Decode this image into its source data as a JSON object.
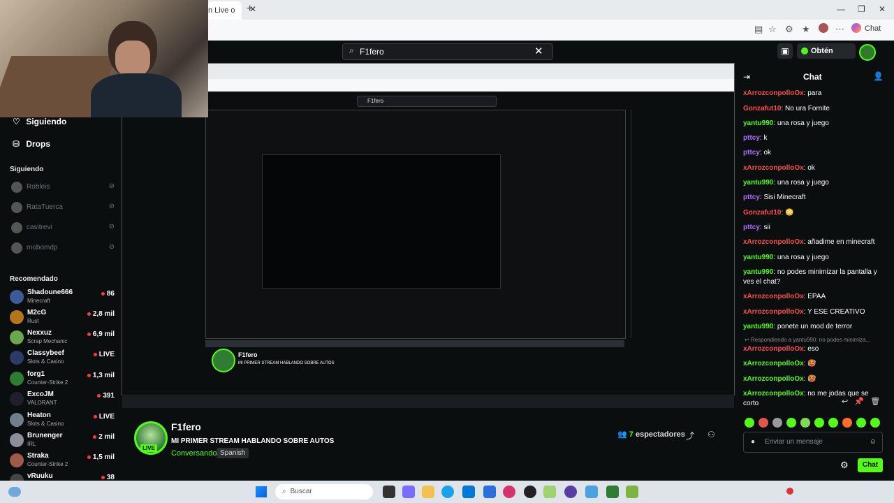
{
  "browser": {
    "tab_title": "n Live o",
    "tab_close": "✕",
    "new_tab": "+",
    "window_controls": [
      "—",
      "❐",
      "✕"
    ],
    "copilot_label": "Chat"
  },
  "header": {
    "search_value": "F1fero",
    "get_kicks_label": "Obtén KICKs"
  },
  "sidebar": {
    "following_link": "Siguiendo",
    "drops_link": "Drops",
    "following_title": "Siguiendo",
    "following": [
      {
        "name": "Robleis"
      },
      {
        "name": "RataTuerca"
      },
      {
        "name": "casitrevi"
      },
      {
        "name": "mobomdp"
      }
    ],
    "recommended_title": "Recomendado",
    "recommended": [
      {
        "name": "Shadoune666",
        "category": "Minecraft",
        "viewers": "86",
        "color": "#3c5a99"
      },
      {
        "name": "M2cG",
        "category": "Rust",
        "viewers": "2,8 mil",
        "color": "#b3761a"
      },
      {
        "name": "Nexxuz",
        "category": "Scrap Mechanic",
        "viewers": "6,9 mil",
        "color": "#6aa84f"
      },
      {
        "name": "Classybeef",
        "category": "Slots & Casino",
        "viewers": "LIVE",
        "color": "#2b3a67"
      },
      {
        "name": "forg1",
        "category": "Counter-Strike 2",
        "viewers": "1,3 mil",
        "color": "#2e7d32"
      },
      {
        "name": "ExcoJM",
        "category": "VALORANT",
        "viewers": "391",
        "color": "#1f1f2e"
      },
      {
        "name": "Heaton",
        "category": "Slots & Casino",
        "viewers": "LIVE",
        "color": "#6f7d8c"
      },
      {
        "name": "Brunenger",
        "category": "IRL",
        "viewers": "2 mil",
        "color": "#8e8e9a"
      },
      {
        "name": "Straka",
        "category": "Counter-Strike 2",
        "viewers": "1,5 mil",
        "color": "#a05a4a"
      },
      {
        "name": "vRuuku",
        "category": "",
        "viewers": "38",
        "color": "#444"
      }
    ]
  },
  "stream": {
    "streamer": "F1fero",
    "title": "MI PRIMER STREAM HABLANDO SOBRE AUTOS",
    "category": "Conversando",
    "language": "Spanish",
    "live_badge": "LIVE",
    "viewers_count": "7",
    "viewers_label": "espectadores",
    "inner_search": "F1fero"
  },
  "chat": {
    "title": "Chat",
    "messages": [
      {
        "user": "xArrozconpolloOx",
        "color": "#ff4d4d",
        "text": ": para"
      },
      {
        "user": "Gonzafut10",
        "color": "#ff4d4d",
        "text": ": No ura Fornite"
      },
      {
        "user": "yantu990",
        "color": "#53fc18",
        "text": ": una rosa y juego"
      },
      {
        "user": "pttcy",
        "color": "#b36bff",
        "text": ": k"
      },
      {
        "user": "pttcy",
        "color": "#b36bff",
        "text": ": ok"
      },
      {
        "user": "xArrozconpolloOx",
        "color": "#ff4d4d",
        "text": ": ok"
      },
      {
        "user": "yantu990",
        "color": "#53fc18",
        "text": ": una rosa y juego"
      },
      {
        "user": "pttcy",
        "color": "#b36bff",
        "text": ": Sisi Minecraft"
      },
      {
        "user": "Gonzafut10",
        "color": "#ff4d4d",
        "text": ": 😳"
      },
      {
        "user": "pttcy",
        "color": "#b36bff",
        "text": ": sii"
      },
      {
        "user": "xArrozconpolloOx",
        "color": "#ff4d4d",
        "text": ": añadime en minecraft"
      },
      {
        "user": "yantu990",
        "color": "#53fc18",
        "text": ": una rosa y juego"
      },
      {
        "user": "yantu990",
        "color": "#53fc18",
        "text": ": no podes minimizar la pantalla y ves el chat?"
      },
      {
        "user": "xArrozconpolloOx",
        "color": "#ff4d4d",
        "text": ": EPAA"
      },
      {
        "user": "xArrozconpolloOx",
        "color": "#ff4d4d",
        "text": ": Y ESE CREATIVO"
      },
      {
        "user": "yantu990",
        "color": "#53fc18",
        "text": ": ponete un mod de terror"
      },
      {
        "user": "xArrozconpolloOx",
        "color": "#ff4d4d",
        "text": ": eso"
      },
      {
        "user": "xArrozconpolloOx",
        "color": "#53fc18",
        "text": ": 🥵"
      },
      {
        "user": "xArrozconpolloOx",
        "color": "#53fc18",
        "text": ": 🥵"
      },
      {
        "user": "xArrozconpolloOx",
        "color": "#53fc18",
        "text": ": no me jodas que se corto"
      }
    ],
    "reply_hint": "Respondiendo a yantu990: no podes minimiza...",
    "input_placeholder": "Enviar un mensaje",
    "send_label": "Chat"
  },
  "taskbar": {
    "search_placeholder": "Buscar"
  }
}
